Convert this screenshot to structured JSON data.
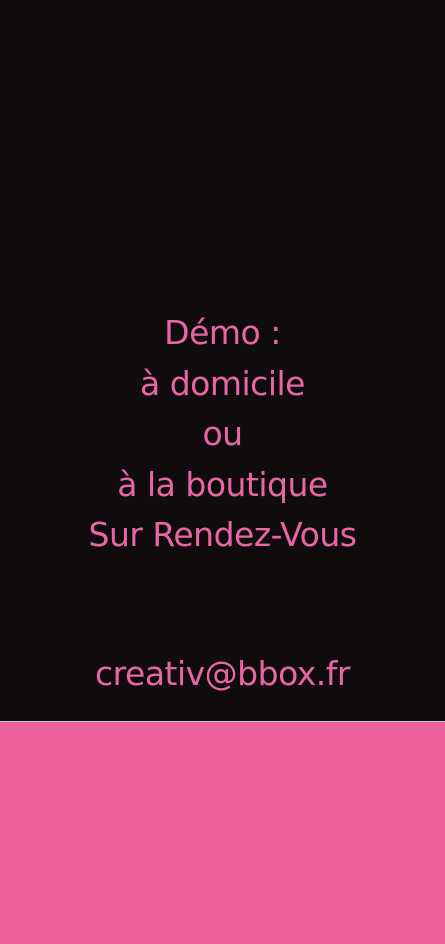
{
  "flyer": {
    "lines": [
      "Démo :",
      "à domicile",
      "ou",
      "à la boutique",
      "Sur Rendez-Vous"
    ],
    "email": "creativ@bbox.fr"
  },
  "colors": {
    "background_dark": "#100c0e",
    "accent_pink": "#e966a6",
    "footer_pink": "#eb5f9d"
  }
}
